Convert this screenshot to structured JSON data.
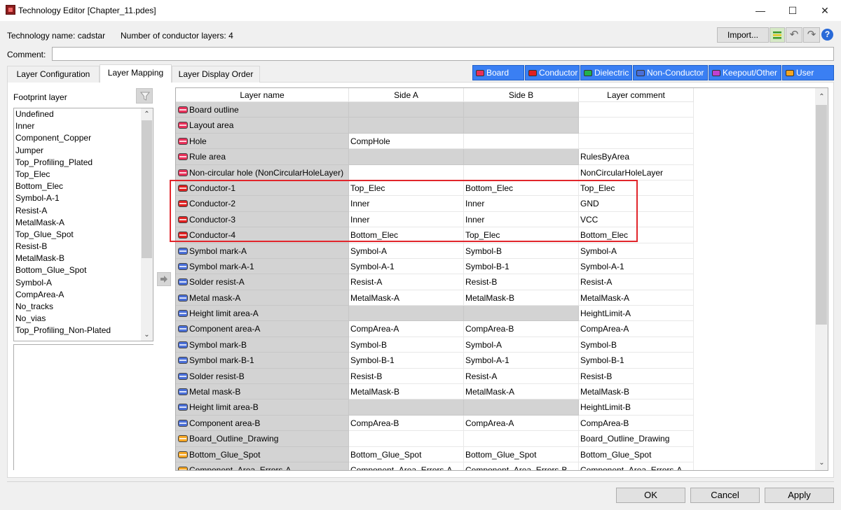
{
  "window": {
    "title": "Technology Editor [Chapter_11.pdes]",
    "minimize": "—",
    "maximize": "☐",
    "close": "✕"
  },
  "info": {
    "technology_name": "Technology name: cadstar",
    "conductor_layers": "Number of conductor layers: 4"
  },
  "toolbar": {
    "import_label": "Import...",
    "undo": "↶",
    "redo": "↷",
    "help": "?"
  },
  "comment": {
    "label": "Comment:",
    "value": ""
  },
  "tabs": [
    {
      "label": "Layer Configuration",
      "active": false
    },
    {
      "label": "Layer Mapping",
      "active": true
    },
    {
      "label": "Layer Display Order",
      "active": false
    }
  ],
  "categories": [
    {
      "label": "Board",
      "color": "#e8305a"
    },
    {
      "label": "Conductor",
      "color": "#e02020"
    },
    {
      "label": "Dielectric",
      "color": "#22b14c"
    },
    {
      "label": "Non-Conductor",
      "color": "#4a6fd8"
    },
    {
      "label": "Keepout/Other",
      "color": "#c040d0"
    },
    {
      "label": "User",
      "color": "#f5a623"
    }
  ],
  "footprint": {
    "label": "Footprint layer",
    "items": [
      "Undefined",
      "Inner",
      "Component_Copper",
      "Jumper",
      "Top_Profiling_Plated",
      "Top_Elec",
      "Bottom_Elec",
      "Symbol-A-1",
      "Resist-A",
      "MetalMask-A",
      "Top_Glue_Spot",
      "Resist-B",
      "MetalMask-B",
      "Bottom_Glue_Spot",
      "Symbol-A",
      "CompArea-A",
      "No_tracks",
      "No_vias",
      "Top_Profiling_Non-Plated"
    ]
  },
  "grid": {
    "headers": [
      "Layer name",
      "Side A",
      "Side B",
      "Layer comment"
    ],
    "rows": [
      {
        "name": "Board outline",
        "type": "board",
        "a": "",
        "b": "",
        "comment": "",
        "a_gray": true,
        "b_gray": true
      },
      {
        "name": "Layout area",
        "type": "board",
        "a": "",
        "b": "",
        "comment": "",
        "a_gray": true,
        "b_gray": true
      },
      {
        "name": "Hole",
        "type": "board",
        "a": "CompHole",
        "b": "",
        "comment": "",
        "a_gray": false,
        "b_gray": false
      },
      {
        "name": "Rule area",
        "type": "board",
        "a": "",
        "b": "",
        "comment": "RulesByArea",
        "a_gray": true,
        "b_gray": true
      },
      {
        "name": "Non-circular hole (NonCircularHoleLayer)",
        "type": "board",
        "a": "",
        "b": "",
        "comment": "NonCircularHoleLayer",
        "a_gray": false,
        "b_gray": false
      },
      {
        "name": "Conductor-1",
        "type": "conductor",
        "a": "Top_Elec",
        "b": "Bottom_Elec",
        "comment": "Top_Elec",
        "a_gray": false,
        "b_gray": false
      },
      {
        "name": "Conductor-2",
        "type": "conductor",
        "a": "Inner",
        "b": "Inner",
        "comment": "GND",
        "a_gray": false,
        "b_gray": false
      },
      {
        "name": "Conductor-3",
        "type": "conductor",
        "a": "Inner",
        "b": "Inner",
        "comment": "VCC",
        "a_gray": false,
        "b_gray": false
      },
      {
        "name": "Conductor-4",
        "type": "conductor",
        "a": "Bottom_Elec",
        "b": "Top_Elec",
        "comment": "Bottom_Elec",
        "a_gray": false,
        "b_gray": false
      },
      {
        "name": "Symbol mark-A",
        "type": "nonconductor",
        "a": "Symbol-A",
        "b": "Symbol-B",
        "comment": "Symbol-A",
        "a_gray": false,
        "b_gray": false
      },
      {
        "name": "Symbol mark-A-1",
        "type": "nonconductor",
        "a": "Symbol-A-1",
        "b": "Symbol-B-1",
        "comment": "Symbol-A-1",
        "a_gray": false,
        "b_gray": false
      },
      {
        "name": "Solder resist-A",
        "type": "nonconductor",
        "a": "Resist-A",
        "b": "Resist-B",
        "comment": "Resist-A",
        "a_gray": false,
        "b_gray": false
      },
      {
        "name": "Metal mask-A",
        "type": "nonconductor",
        "a": "MetalMask-A",
        "b": "MetalMask-B",
        "comment": "MetalMask-A",
        "a_gray": false,
        "b_gray": false
      },
      {
        "name": "Height limit area-A",
        "type": "nonconductor",
        "a": "",
        "b": "",
        "comment": "HeightLimit-A",
        "a_gray": true,
        "b_gray": true
      },
      {
        "name": "Component area-A",
        "type": "nonconductor",
        "a": "CompArea-A",
        "b": "CompArea-B",
        "comment": "CompArea-A",
        "a_gray": false,
        "b_gray": false
      },
      {
        "name": "Symbol mark-B",
        "type": "nonconductor",
        "a": "Symbol-B",
        "b": "Symbol-A",
        "comment": "Symbol-B",
        "a_gray": false,
        "b_gray": false
      },
      {
        "name": "Symbol mark-B-1",
        "type": "nonconductor",
        "a": "Symbol-B-1",
        "b": "Symbol-A-1",
        "comment": "Symbol-B-1",
        "a_gray": false,
        "b_gray": false
      },
      {
        "name": "Solder resist-B",
        "type": "nonconductor",
        "a": "Resist-B",
        "b": "Resist-A",
        "comment": "Resist-B",
        "a_gray": false,
        "b_gray": false
      },
      {
        "name": "Metal mask-B",
        "type": "nonconductor",
        "a": "MetalMask-B",
        "b": "MetalMask-A",
        "comment": "MetalMask-B",
        "a_gray": false,
        "b_gray": false
      },
      {
        "name": "Height limit area-B",
        "type": "nonconductor",
        "a": "",
        "b": "",
        "comment": "HeightLimit-B",
        "a_gray": true,
        "b_gray": true
      },
      {
        "name": "Component area-B",
        "type": "nonconductor",
        "a": "CompArea-B",
        "b": "CompArea-A",
        "comment": "CompArea-B",
        "a_gray": false,
        "b_gray": false
      },
      {
        "name": "Board_Outline_Drawing",
        "type": "user",
        "a": "",
        "b": "",
        "comment": "Board_Outline_Drawing",
        "a_gray": false,
        "b_gray": false
      },
      {
        "name": "Bottom_Glue_Spot",
        "type": "user",
        "a": "Bottom_Glue_Spot",
        "b": "Bottom_Glue_Spot",
        "comment": "Bottom_Glue_Spot",
        "a_gray": false,
        "b_gray": false
      },
      {
        "name": "Component_Area_Errors-A",
        "type": "user",
        "a": "Component_Area_Errors-A",
        "b": "Component_Area_Errors-B",
        "comment": "Component_Area_Errors-A",
        "a_gray": false,
        "b_gray": false
      }
    ]
  },
  "buttons": {
    "ok": "OK",
    "cancel": "Cancel",
    "apply": "Apply"
  },
  "colors": {
    "board": "#e8305a",
    "conductor": "#e02020",
    "nonconductor": "#4a6fd8",
    "user": "#f5a623",
    "highlight": "#e1252b"
  }
}
